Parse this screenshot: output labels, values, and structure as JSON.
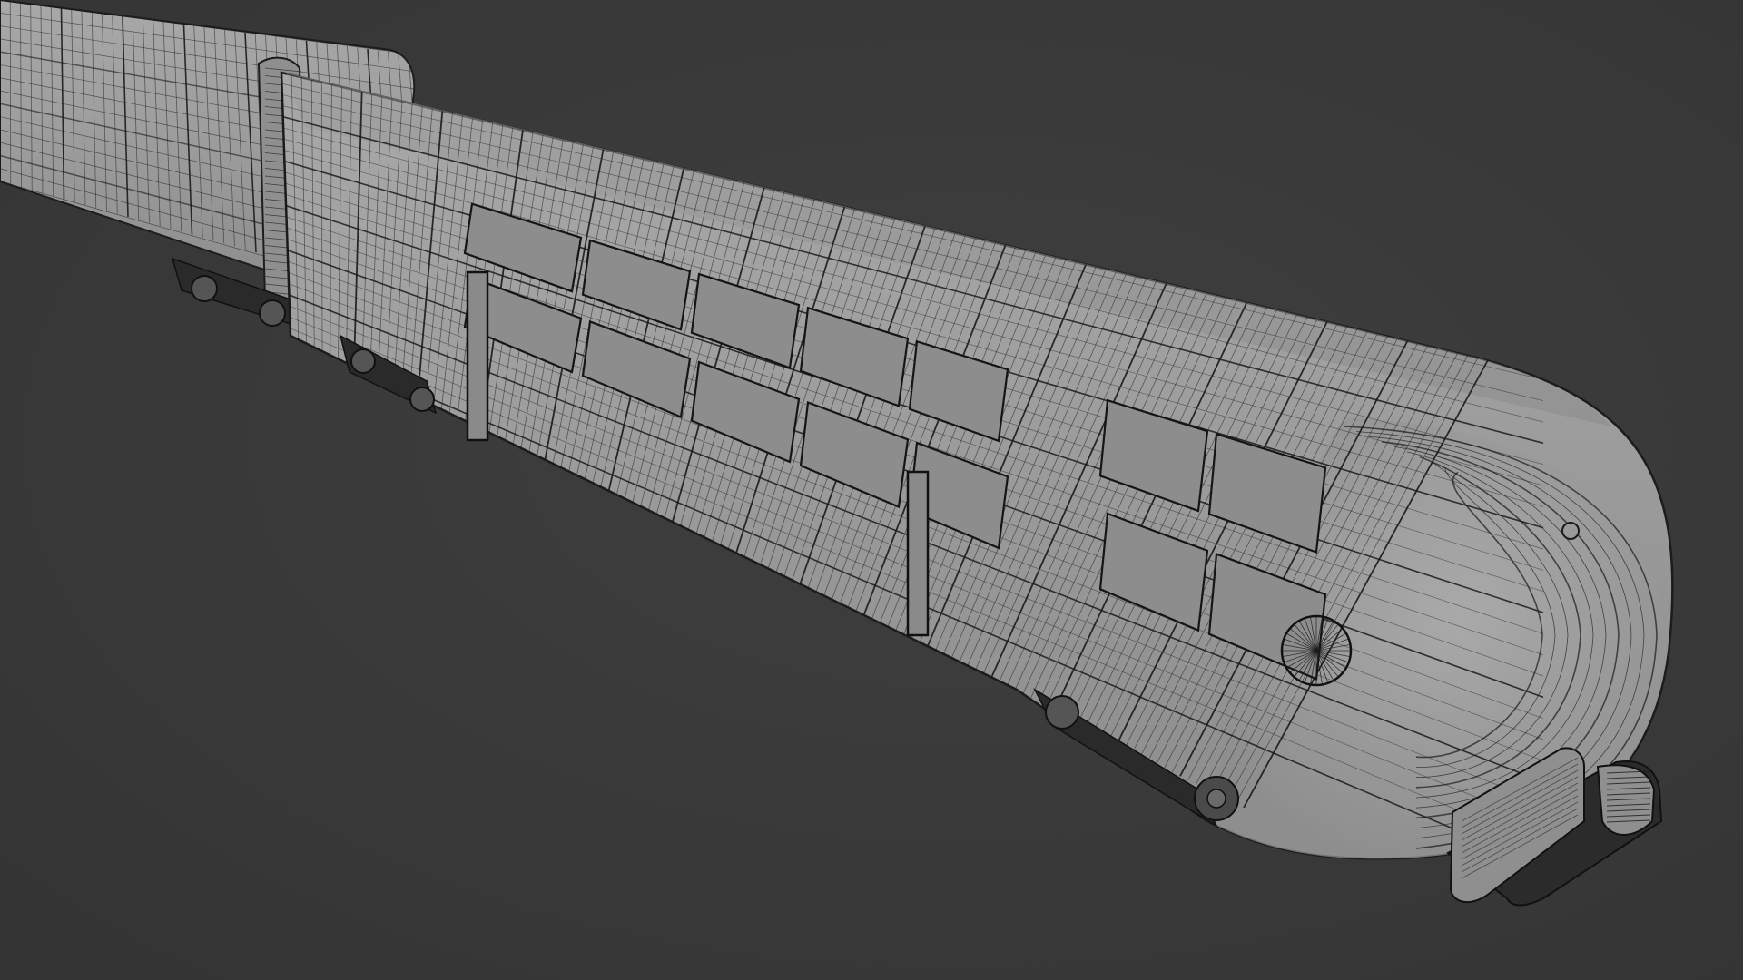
{
  "scene": {
    "subject": "train-wireframe-model",
    "background_color": "#3a3a3a",
    "body_color": "#9a9a9a",
    "body_shadow_color": "#7c7c7c",
    "wire_color": "#1a1a1a",
    "undercarriage_color": "#2a2a2a"
  }
}
